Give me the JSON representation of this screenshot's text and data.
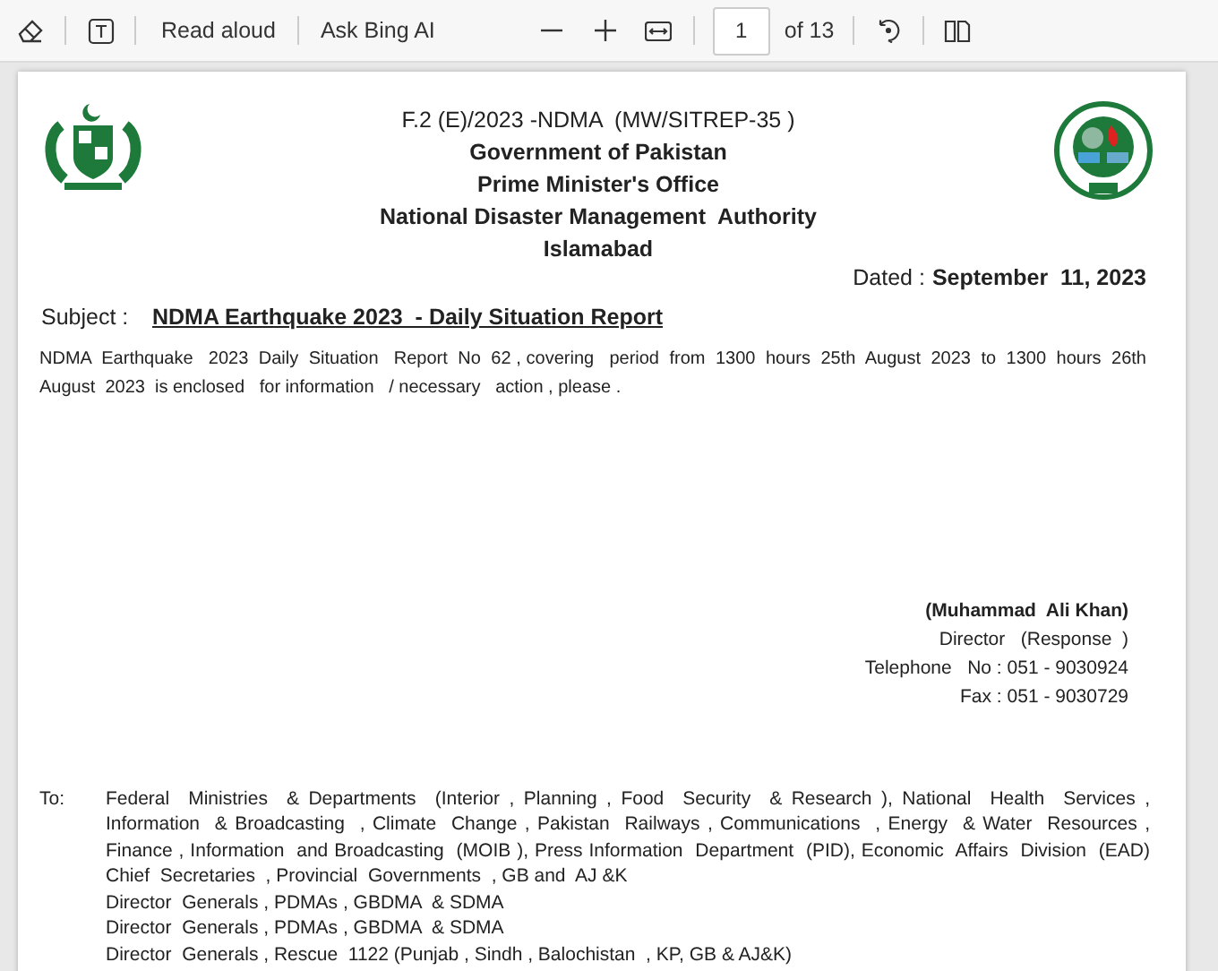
{
  "toolbar": {
    "read_aloud": "Read aloud",
    "ask_ai": "Ask Bing AI",
    "page_number": "1",
    "page_count": "of 13"
  },
  "document": {
    "reference": "F.2 (E)/2023 -NDMA  (MW/SITREP-35 )",
    "heading_lines": [
      "Government of Pakistan",
      "Prime Minister's Office",
      "National Disaster Management  Authority",
      "Islamabad"
    ],
    "dated_label": "Dated :",
    "dated_value": "September  11, 2023",
    "subject_label": "Subject :",
    "subject_value": "NDMA Earthquake 2023  - Daily Situation Report",
    "body": "NDMA  Earthquake   2023  Daily  Situation   Report  No  62 , covering   period  from  1300  hours  25th  August  2023  to  1300  hours  26th  August  2023  is enclosed   for information   / necessary   action , please .",
    "signature": [
      {
        "kind": "name",
        "text": "(Muhammad  Ali Khan)"
      },
      {
        "kind": "line",
        "text": "Director   (Response  )"
      },
      {
        "kind": "line",
        "text": "Telephone   No : 051 - 9030924"
      },
      {
        "kind": "line",
        "text": "Fax : 051 - 9030729"
      }
    ],
    "to_label": "To:",
    "recipients": [
      {
        "kind": "justified",
        "text": "Federal  Ministries  & Departments  (Interior , Planning , Food  Security  & Research ), National  Health  Services ,"
      },
      {
        "kind": "justified",
        "text": "Information  & Broadcasting  , Climate  Change , Pakistan  Railways , Communications  , Energy  & Water  Resources ,"
      },
      {
        "kind": "justified",
        "text": "Finance , Information  and Broadcasting  (MOIB ), Press Information  Department  (PID), Economic  Affairs  Division  (EAD)"
      },
      {
        "kind": "plain",
        "text": "Chief  Secretaries  , Provincial  Governments  , GB and  AJ &K"
      },
      {
        "kind": "plain",
        "text": "Director  Generals , PDMAs , GBDMA  & SDMA"
      },
      {
        "kind": "plain",
        "text": "Director  Generals , PDMAs , GBDMA  & SDMA"
      },
      {
        "kind": "plain",
        "text": "Director  Generals , Rescue  1122 (Punjab , Sindh , Balochistan  , KP, GB & AJ&K)"
      }
    ]
  }
}
